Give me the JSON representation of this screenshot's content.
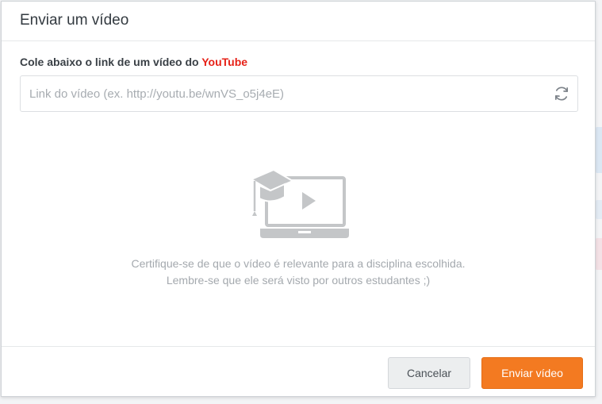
{
  "dialog": {
    "title": "Enviar um vídeo",
    "prompt_text": "Cole abaixo o link de um vídeo do ",
    "prompt_brand": "YouTube",
    "url_input": {
      "value": "",
      "placeholder": "Link do vídeo (ex. http://youtu.be/wnVS_o5j4eE)"
    },
    "refresh_icon": "refresh-icon",
    "illustration_icon": "laptop-video-graduation-cap-icon",
    "hint_line_1": "Certifique-se de que o vídeo é relevante para a disciplina escolhida.",
    "hint_line_2": "Lembre-se que ele será visto por outros estudantes ;)",
    "cancel_label": "Cancelar",
    "submit_label": "Enviar vídeo"
  },
  "colors": {
    "brand_red": "#e62117",
    "submit_orange": "#f37a21",
    "illustration_gray": "#c4c6c8"
  }
}
